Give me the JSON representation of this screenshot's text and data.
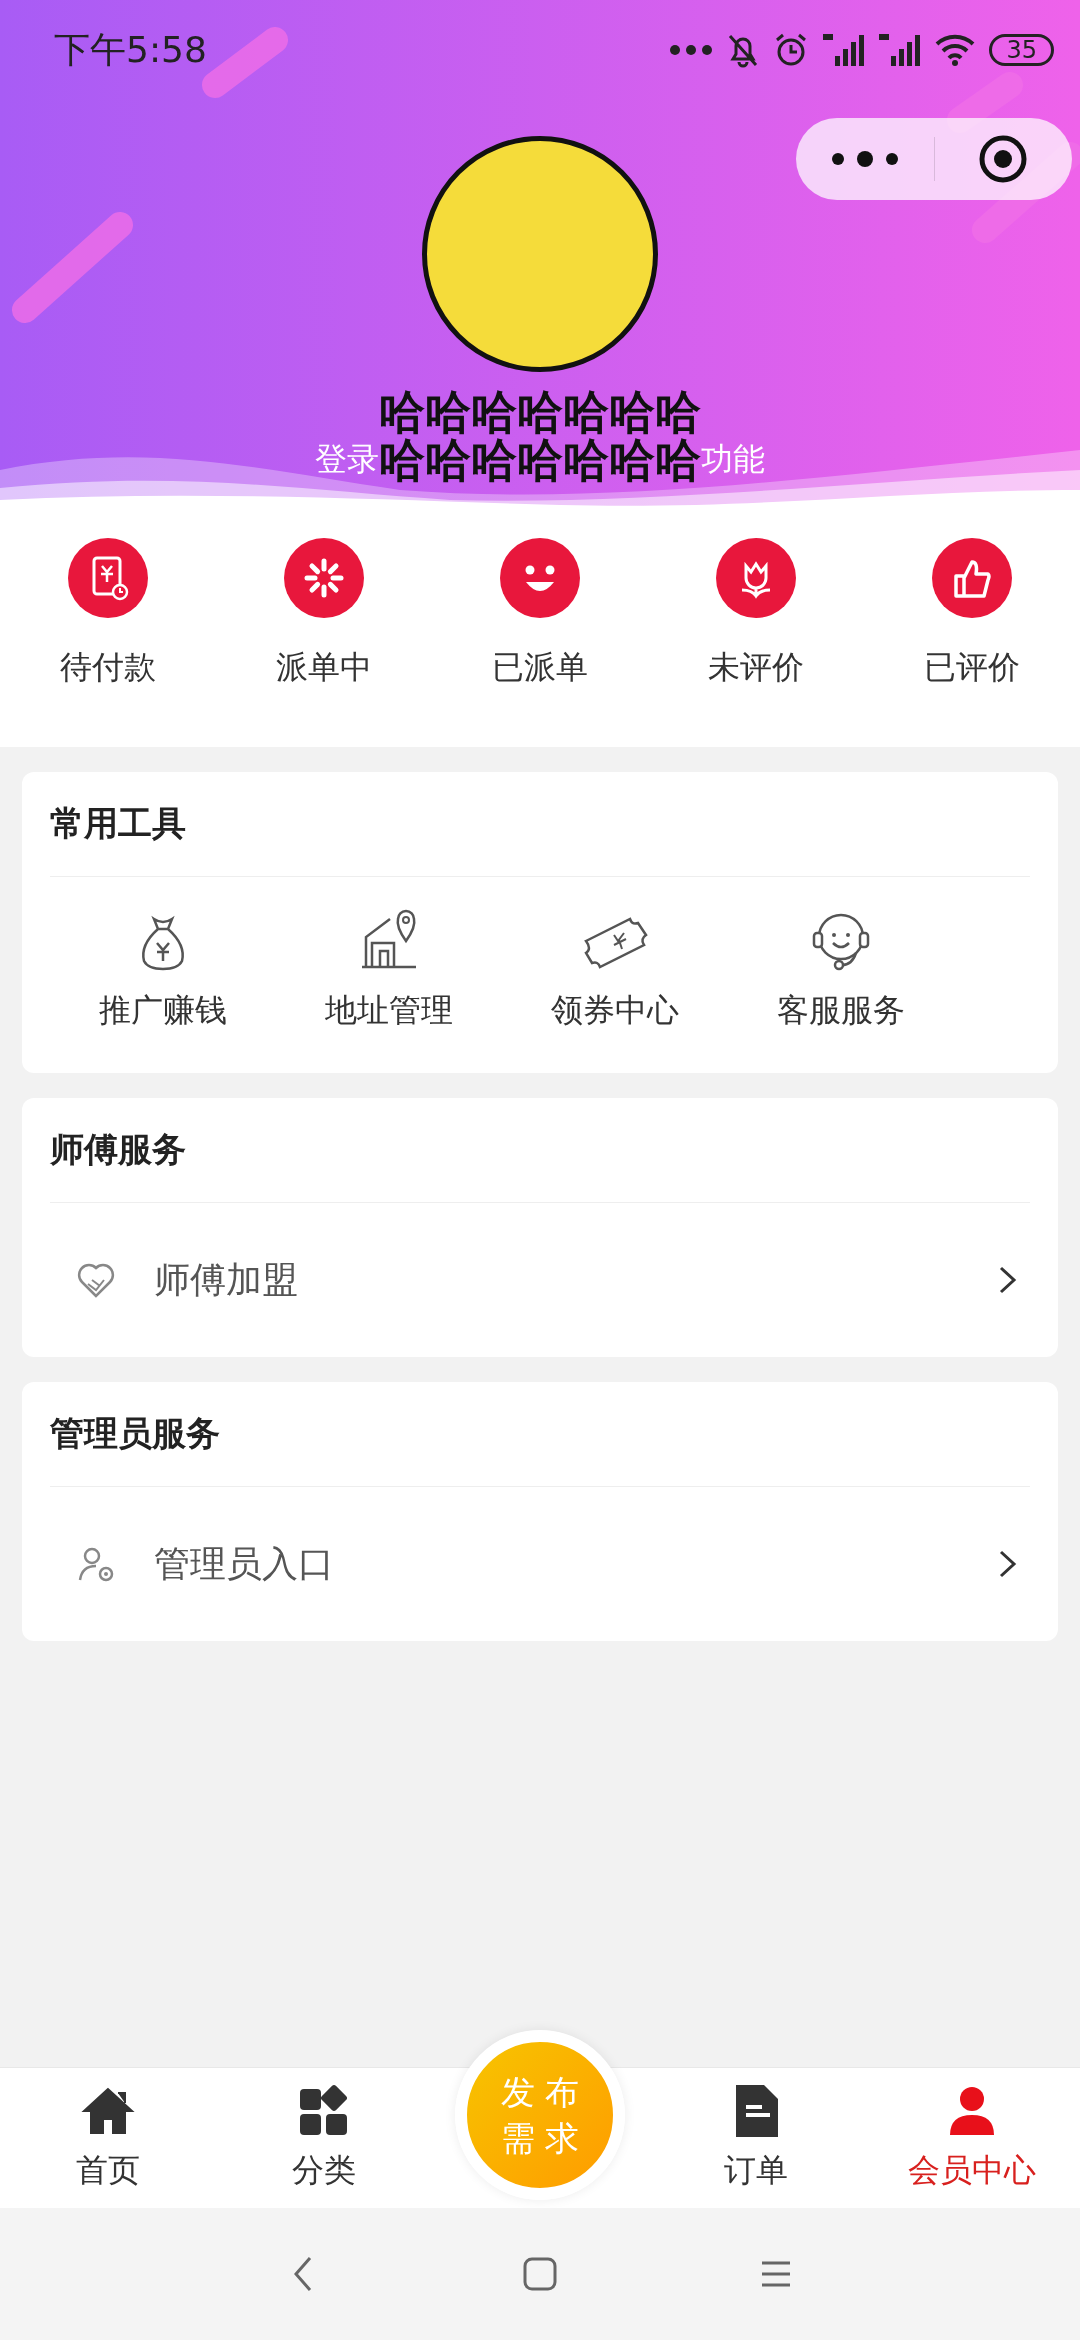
{
  "status_bar": {
    "time": "下午5:58",
    "battery": "35"
  },
  "profile": {
    "nickname_lines": [
      "哈哈哈哈哈哈哈",
      "哈哈哈哈哈哈哈"
    ],
    "login_hint_left": "登录",
    "login_hint_right": "功能"
  },
  "order_statuses": [
    {
      "label": "待付款"
    },
    {
      "label": "派单中"
    },
    {
      "label": "已派单"
    },
    {
      "label": "未评价"
    },
    {
      "label": "已评价"
    }
  ],
  "sections": [
    {
      "title": "常用工具",
      "kind": "grid",
      "items": [
        {
          "label": "推广赚钱"
        },
        {
          "label": "地址管理"
        },
        {
          "label": "领券中心"
        },
        {
          "label": "客服服务"
        }
      ]
    },
    {
      "title": "师傅服务",
      "kind": "list",
      "items": [
        {
          "label": "师傅加盟"
        }
      ]
    },
    {
      "title": "管理员服务",
      "kind": "list",
      "items": [
        {
          "label": "管理员入口"
        }
      ]
    }
  ],
  "tab_bar": {
    "items": [
      {
        "label": "首页",
        "selected": false
      },
      {
        "label": "分类",
        "selected": false
      },
      {
        "label": "订单",
        "selected": false
      },
      {
        "label": "会员中心",
        "selected": true
      }
    ],
    "publish_button": {
      "lines": [
        "发布",
        "需求"
      ]
    }
  }
}
